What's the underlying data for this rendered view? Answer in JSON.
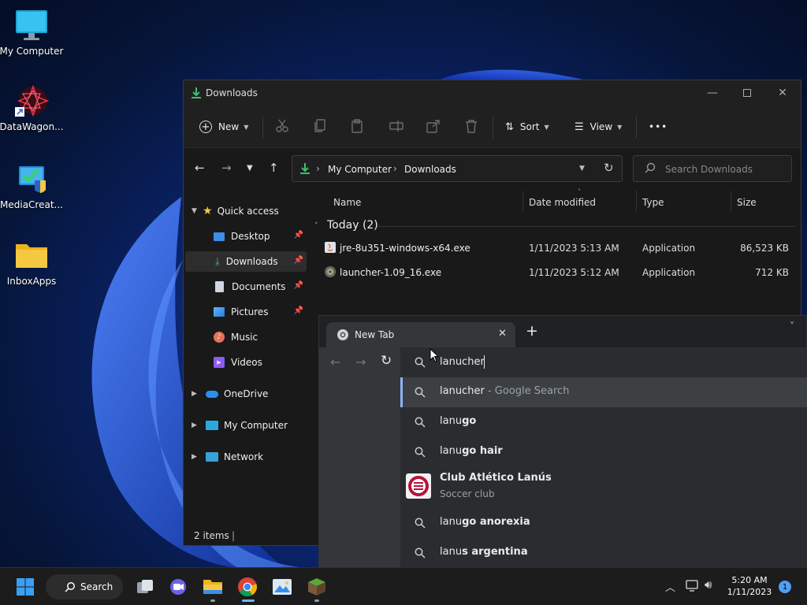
{
  "desktop": {
    "icons": [
      {
        "label": "My Computer",
        "icon": "monitor-icon"
      },
      {
        "label": "DataWagon...",
        "icon": "datawagon-icon"
      },
      {
        "label": "MediaCreat...",
        "icon": "media-creation-icon"
      },
      {
        "label": "InboxApps",
        "icon": "folder-icon"
      }
    ]
  },
  "explorer": {
    "title": "Downloads",
    "toolbar": {
      "new_label": "New",
      "sort_label": "Sort",
      "view_label": "View",
      "more_label": "•••"
    },
    "address": {
      "crumbs": [
        "My Computer",
        "Downloads"
      ],
      "search_placeholder": "Search Downloads"
    },
    "sidebar": {
      "quick_access": "Quick access",
      "items": [
        {
          "label": "Desktop"
        },
        {
          "label": "Downloads"
        },
        {
          "label": "Documents"
        },
        {
          "label": "Pictures"
        },
        {
          "label": "Music"
        },
        {
          "label": "Videos"
        }
      ],
      "onedrive": "OneDrive",
      "my_computer": "My Computer",
      "network": "Network"
    },
    "columns": {
      "name": "Name",
      "date": "Date modified",
      "type": "Type",
      "size": "Size"
    },
    "group": "Today (2)",
    "files": [
      {
        "name": "jre-8u351-windows-x64.exe",
        "date": "1/11/2023 5:13 AM",
        "type": "Application",
        "size": "86,523 KB"
      },
      {
        "name": "launcher-1.09_16.exe",
        "date": "1/11/2023 5:12 AM",
        "type": "Application",
        "size": "712 KB"
      }
    ],
    "status": "2 items"
  },
  "chrome": {
    "tab_title": "New Tab",
    "omnibox_value": "lanucher",
    "suggestions": [
      {
        "typed": "lanucher",
        "rest": " - Google Search"
      },
      {
        "typed": "lanu",
        "rest": "go"
      },
      {
        "typed": "lanu",
        "rest": "go hair"
      },
      {
        "title": "Club Atlético Lanús",
        "subtitle": "Soccer club"
      },
      {
        "typed": "lanu",
        "rest": "go anorexia"
      },
      {
        "typed": "lanu",
        "rest": "s argentina"
      }
    ]
  },
  "taskbar": {
    "search_label": "Search",
    "clock_time": "5:20 AM",
    "clock_date": "1/11/2023",
    "notification_count": "1"
  },
  "colors": {
    "accent": "#6fb4ff",
    "chrome_accent": "#8ab4f8",
    "folder_yellow": "#f5c842",
    "download_green": "#3fbf6f"
  }
}
